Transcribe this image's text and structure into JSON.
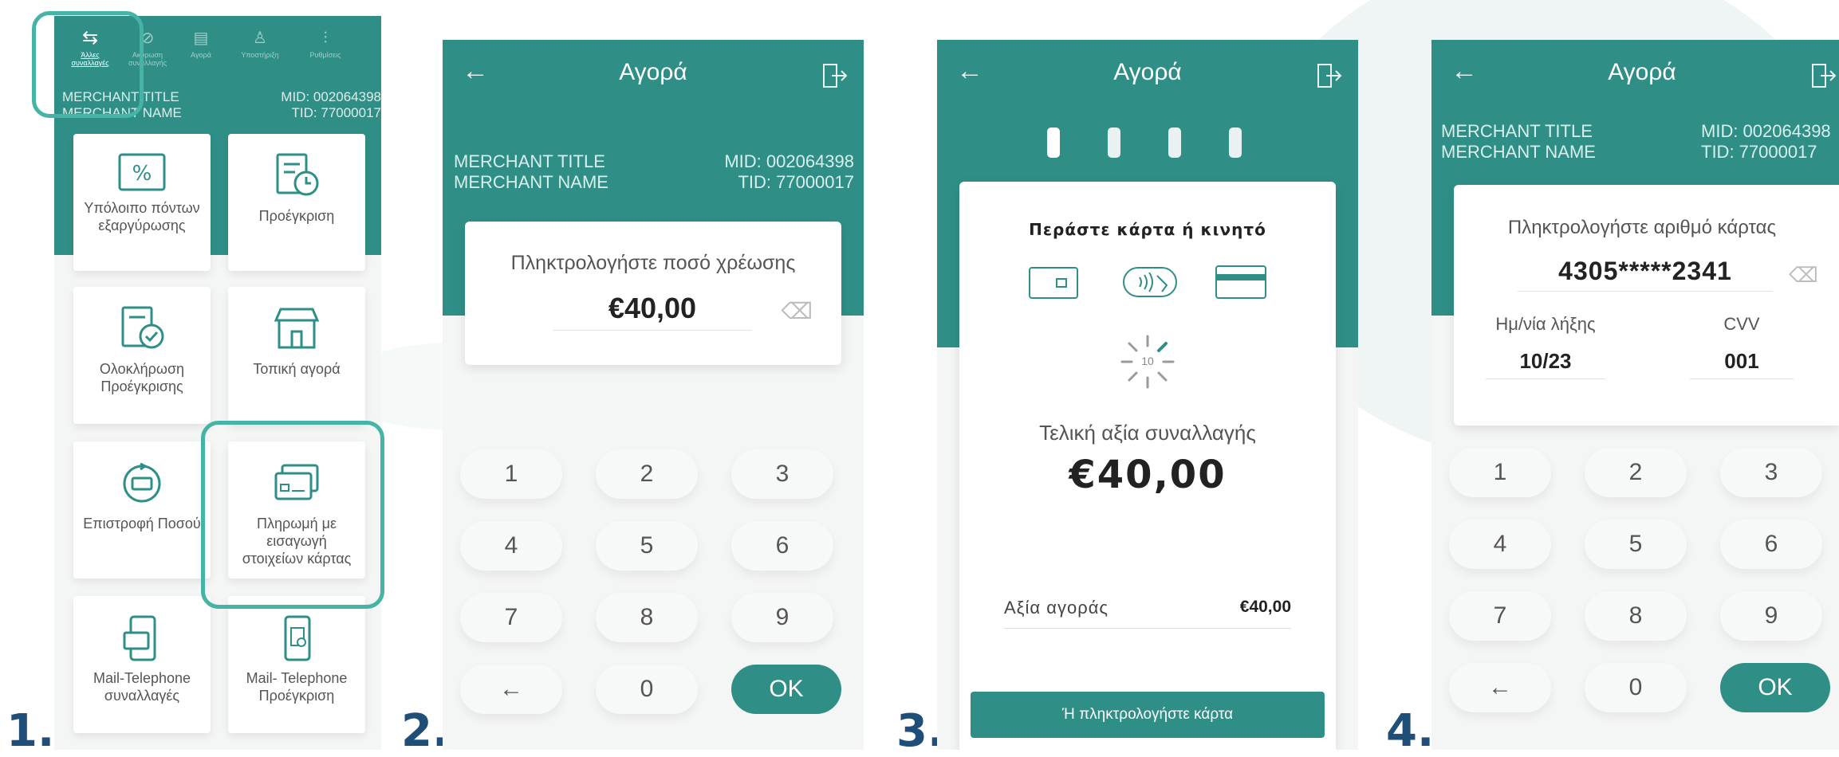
{
  "step_labels": [
    "1.",
    "2.",
    "3.",
    "4."
  ],
  "merchant": {
    "title": "MERCHANT TITLE",
    "name": "MERCHANT NAME",
    "mid": "MID: 002064398",
    "tid": "TID: 77000017"
  },
  "screen1": {
    "top_tabs": [
      {
        "label": "Άλλες συναλλαγές",
        "icon": "arrows-icon"
      },
      {
        "label": "Ακύρωση συναλλαγής",
        "icon": "cancel-icon"
      },
      {
        "label": "Αγορά",
        "icon": "purchase-icon"
      },
      {
        "label": "Υποστήριξη",
        "icon": "support-icon"
      },
      {
        "label": "Ρυθμίσεις",
        "icon": "settings-icon"
      }
    ],
    "tiles": [
      {
        "label": "Υπόλοιπο πόντων εξαργύρωσης",
        "icon": "percent-voucher-icon"
      },
      {
        "label": "Προέγκριση",
        "icon": "document-clock-icon"
      },
      {
        "label": "Ολοκλήρωση Προέγκρισης",
        "icon": "document-check-icon"
      },
      {
        "label": "Τοπική αγορά",
        "icon": "shop-icon"
      },
      {
        "label": "Επιστροφή Ποσού",
        "icon": "refund-icon"
      },
      {
        "label": "Πληρωμή με εισαγωγή στοιχείων κάρτας",
        "icon": "cards-icon"
      },
      {
        "label": "Mail-Telephone συναλλαγές",
        "icon": "phone-card-icon"
      },
      {
        "label": "Mail- Telephone Προέγκριση",
        "icon": "phone-document-icon"
      }
    ]
  },
  "screen2": {
    "title": "Αγορά",
    "prompt": "Πληκτρολογήστε ποσό χρέωσης",
    "amount": "€40,00",
    "keys": [
      "1",
      "2",
      "3",
      "4",
      "5",
      "6",
      "7",
      "8",
      "9",
      "←",
      "0"
    ],
    "ok": "OK"
  },
  "screen3": {
    "title": "Αγορά",
    "prompt": "Περάστε κάρτα ή κινητό",
    "countdown": "10",
    "total_label": "Τελική αξία συναλλαγής",
    "total_amount": "€40,00",
    "purchase_label": "Αξία αγοράς",
    "purchase_amount": "€40,00",
    "button": "Ή πληκτρολογήστε κάρτα"
  },
  "screen4": {
    "title": "Αγορά",
    "prompt": "Πληκτρολογήστε αριθμό κάρτας",
    "card_number": "4305*****2341",
    "expiry_label": "Ημ/νία λήξης",
    "expiry_value": "10/23",
    "cvv_label": "CVV",
    "cvv_value": "001",
    "keys": [
      "1",
      "2",
      "3",
      "4",
      "5",
      "6",
      "7",
      "8",
      "9",
      "←",
      "0"
    ],
    "ok": "OK"
  },
  "colors": {
    "teal": "#2f8f86",
    "highlight": "#45b3a6",
    "step_number": "#1f4e79"
  }
}
